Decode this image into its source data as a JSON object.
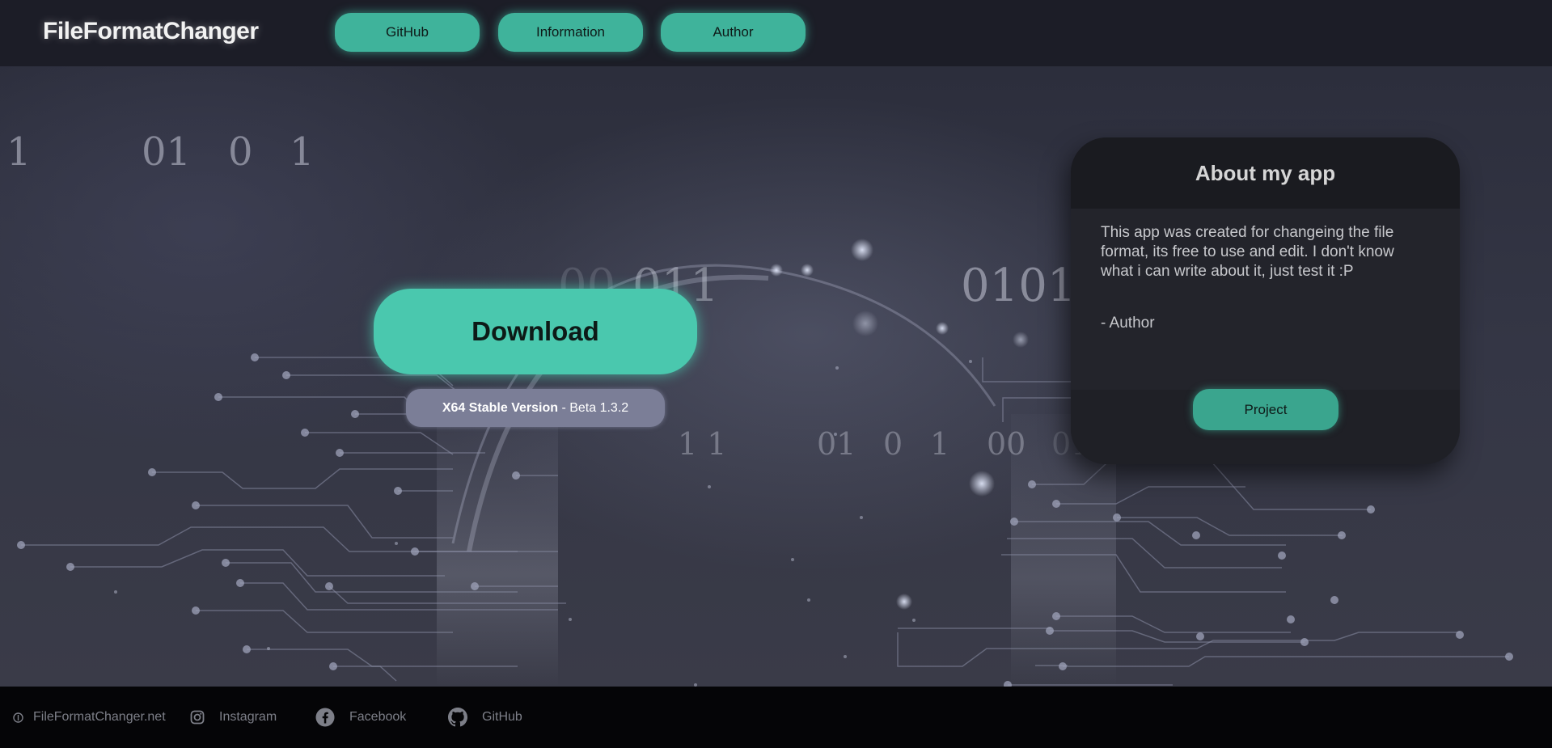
{
  "header": {
    "logo": "FileFormatChanger",
    "nav": [
      "GitHub",
      "Information",
      "Author"
    ]
  },
  "hero": {
    "download_label": "Download",
    "version_strong": "X64 Stable Version",
    "version_rest": " - Beta 1.3.2",
    "binary_texts": [
      "1",
      "01",
      "0",
      "1",
      "00",
      "011",
      "0101",
      "1 1",
      "01",
      "0",
      "1",
      "00",
      "011",
      "0101"
    ]
  },
  "about": {
    "title": "About my app",
    "text": "This app was created for changeing the file format, its free to use and edit. I don't know what i can write about it, just test it :P",
    "author": "- Author",
    "button": "Project"
  },
  "footer": {
    "items": [
      {
        "label": "FileFormatChanger.net",
        "icon": "info-icon"
      },
      {
        "label": "Instagram",
        "icon": "instagram-icon"
      },
      {
        "label": "Facebook",
        "icon": "facebook-icon"
      },
      {
        "label": "GitHub",
        "icon": "github-icon"
      }
    ]
  },
  "colors": {
    "accent": "#3fb39b",
    "download": "#4ac8ae",
    "header_bg": "#1c1d27",
    "footer_bg": "#050507",
    "card_bg": "#1e1f25"
  }
}
